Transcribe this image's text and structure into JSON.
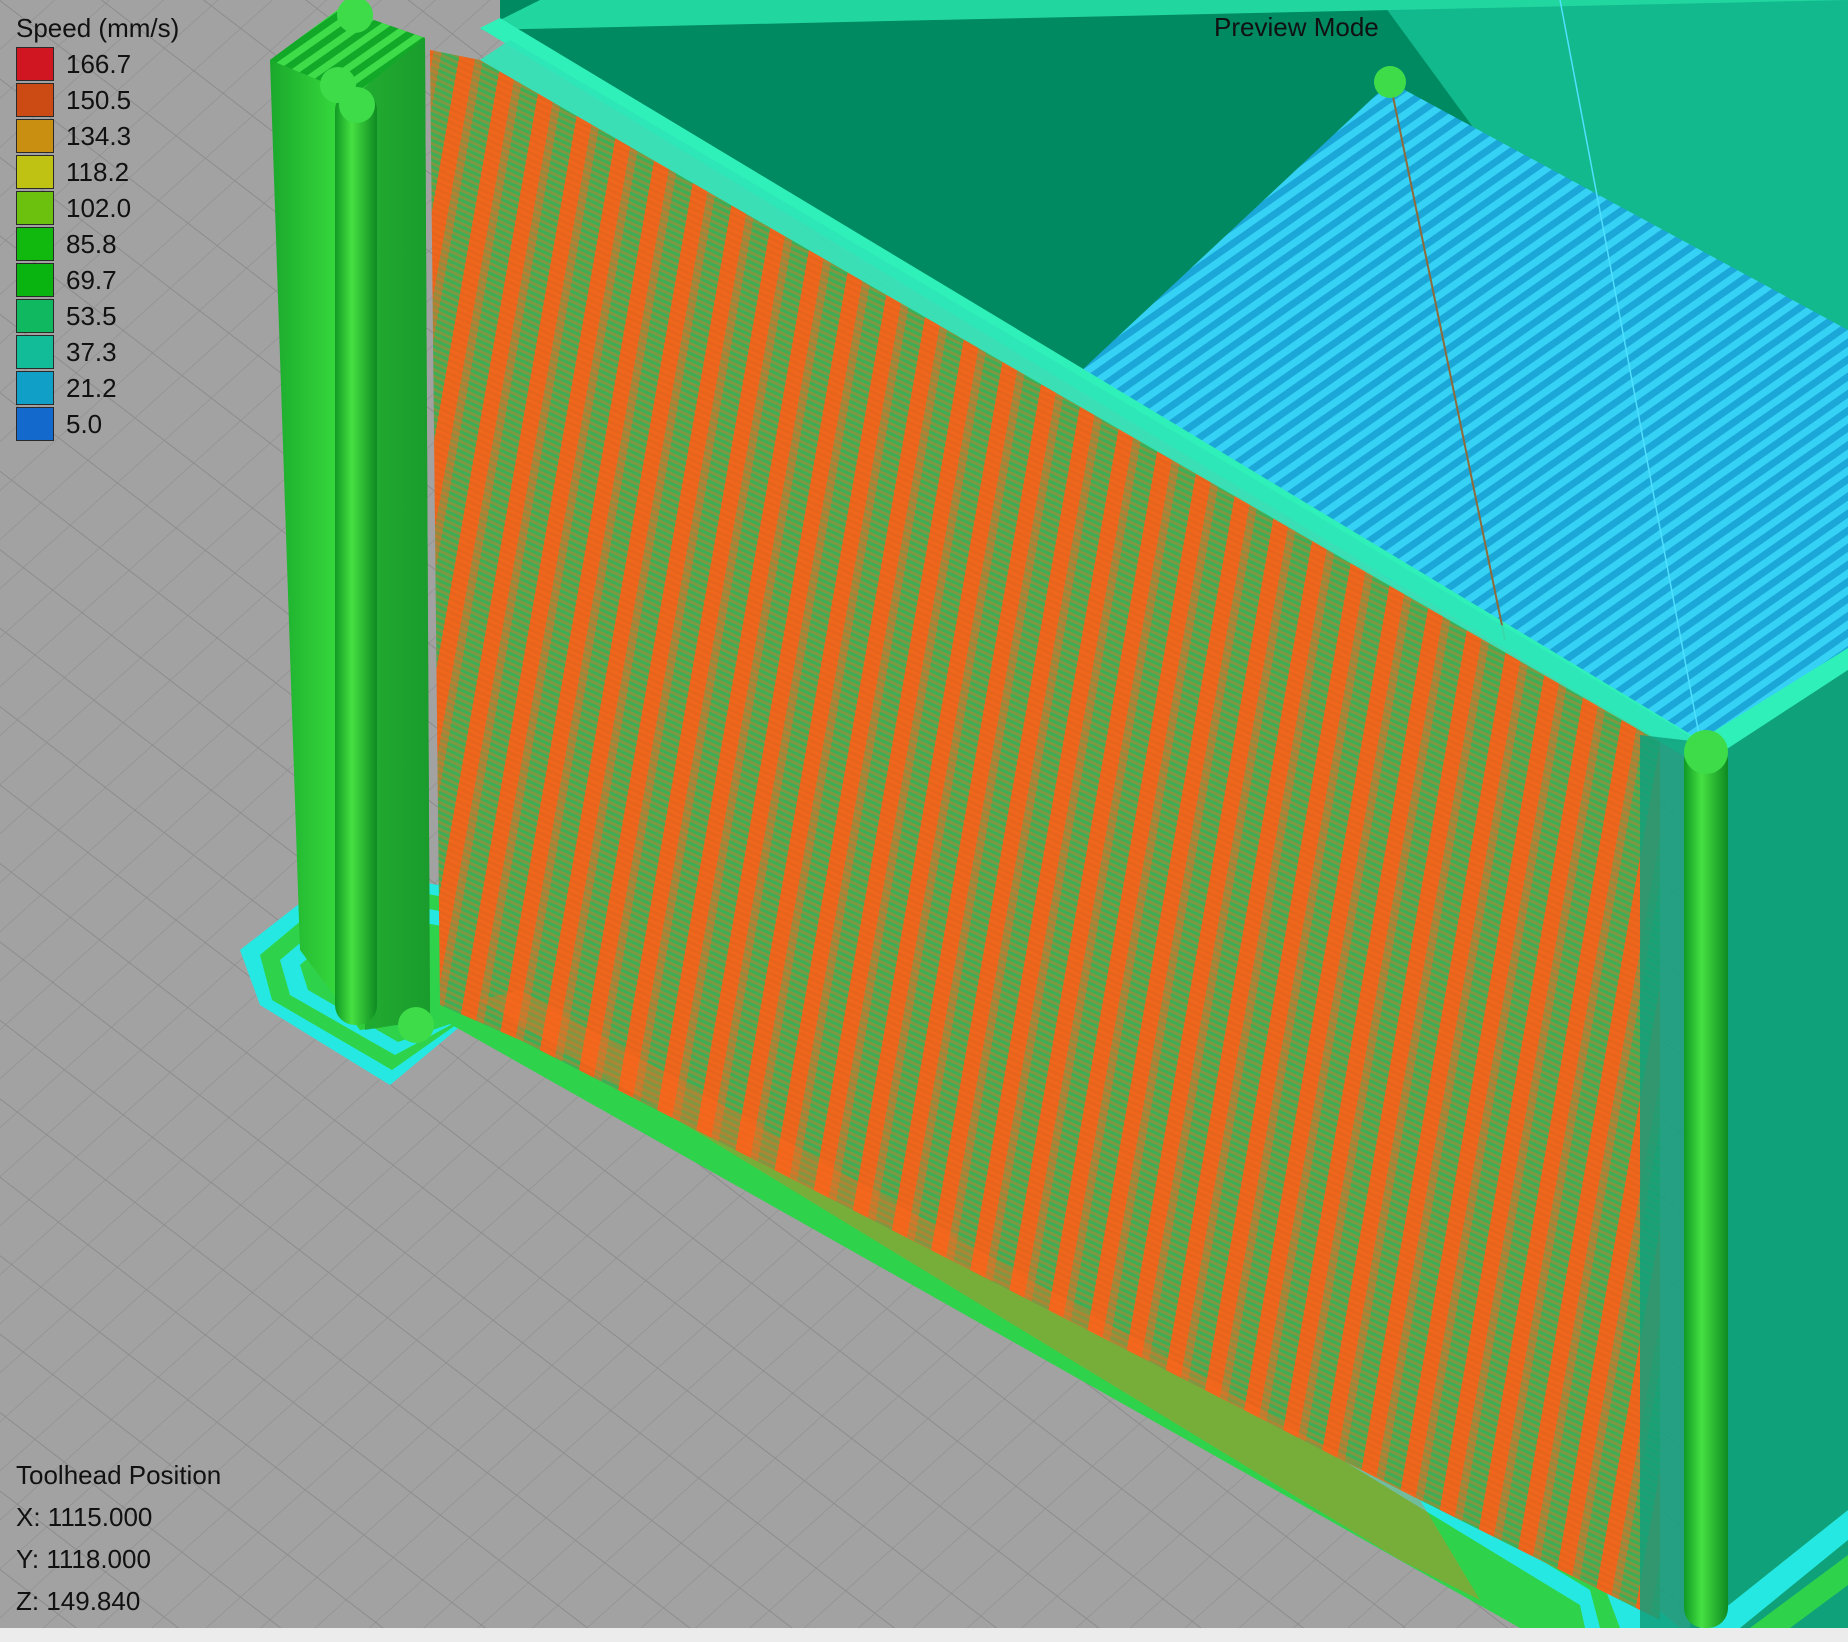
{
  "header": {
    "mode_label": "Preview Mode"
  },
  "legend": {
    "title": "Speed (mm/s)",
    "items": [
      {
        "value": "166.7",
        "color": "#d01621"
      },
      {
        "value": "150.5",
        "color": "#cc4a13"
      },
      {
        "value": "134.3",
        "color": "#c88f10"
      },
      {
        "value": "118.2",
        "color": "#bfc212"
      },
      {
        "value": "102.0",
        "color": "#6cc00e"
      },
      {
        "value": "85.8",
        "color": "#11b80e"
      },
      {
        "value": "69.7",
        "color": "#0ab410"
      },
      {
        "value": "53.5",
        "color": "#10b85f"
      },
      {
        "value": "37.3",
        "color": "#12bc98"
      },
      {
        "value": "21.2",
        "color": "#109fc6"
      },
      {
        "value": "5.0",
        "color": "#1469cc"
      }
    ]
  },
  "toolhead": {
    "title": "Toolhead Position",
    "x": "X: 1115.000",
    "y": "Y: 1118.000",
    "z": "Z: 149.840"
  },
  "scene": {
    "background_color": "#a2a2a2",
    "grid_color": "#8c8c8c",
    "tower_color": "#23c73a",
    "wall_color": "#049a6a",
    "top_infill_color": "#32c7ee",
    "skirt_color": "#25e8e2",
    "extrusion_color": "#ee5a18"
  }
}
